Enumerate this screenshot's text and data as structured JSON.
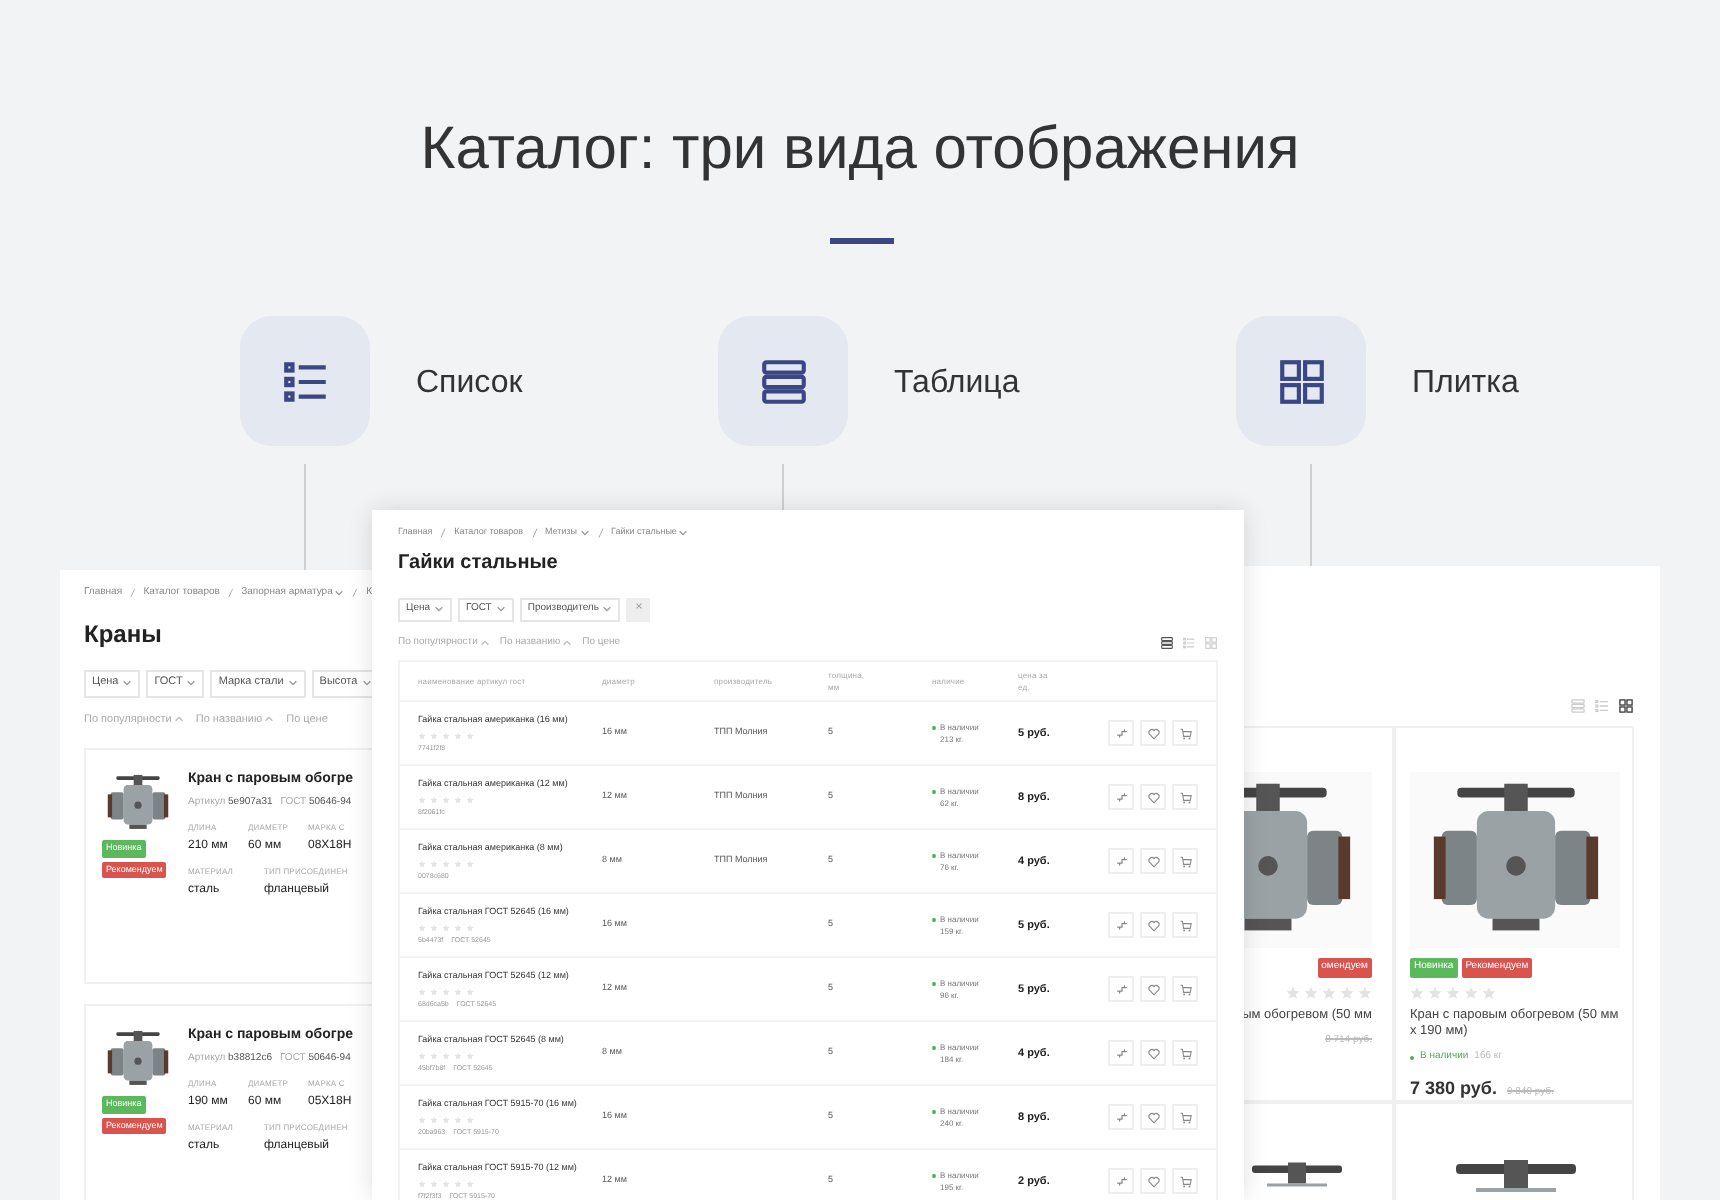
{
  "heading": {
    "title": "Каталог: три вида отображения",
    "views": [
      {
        "kind": "list",
        "label": "Список"
      },
      {
        "kind": "table",
        "label": "Таблица"
      },
      {
        "kind": "tile",
        "label": "Плитка"
      }
    ]
  },
  "list_view": {
    "breadcrumbs": [
      {
        "label": "Главная",
        "dropdown": false
      },
      {
        "label": "Каталог товаров",
        "dropdown": false
      },
      {
        "label": "Запорная арматура",
        "dropdown": true
      },
      {
        "label": "К",
        "dropdown": false
      }
    ],
    "title": "Краны",
    "filters": [
      "Цена",
      "ГОСТ",
      "Марка стали",
      "Высота"
    ],
    "sort": [
      {
        "label": "По популярности",
        "arrow": true
      },
      {
        "label": "По названию",
        "arrow": true
      },
      {
        "label": "По цене",
        "arrow": false
      }
    ],
    "products": [
      {
        "title": "Кран с паровым обогре",
        "sku_label": "Артикул",
        "sku": "5e907a31",
        "gost_label": "ГОСТ",
        "gost": "50646-94",
        "specs": [
          {
            "label": "ДЛИНА",
            "value": "210 мм"
          },
          {
            "label": "ДИАМЕТР",
            "value": "60 мм"
          },
          {
            "label": "МАРКА С",
            "value": "08Х18Н"
          }
        ],
        "specs2": [
          {
            "label": "МАТЕРИАЛ",
            "value": "сталь"
          },
          {
            "label": "ТИП ПРИСОЕДИНЕН",
            "value": "фланцевый"
          }
        ],
        "tags": [
          {
            "label": "Новинка",
            "color": "#5cb85c"
          },
          {
            "label": "Рекомендуем",
            "color": "#d9534f"
          }
        ]
      },
      {
        "title": "Кран с паровым обогре",
        "sku_label": "Артикул",
        "sku": "b38812c6",
        "gost_label": "ГОСТ",
        "gost": "50646-94",
        "specs": [
          {
            "label": "ДЛИНА",
            "value": "190 мм"
          },
          {
            "label": "ДИАМЕТР",
            "value": "60 мм"
          },
          {
            "label": "МАРКА С",
            "value": "05Х18Н"
          }
        ],
        "specs2": [
          {
            "label": "МАТЕРИАЛ",
            "value": "сталь"
          },
          {
            "label": "ТИП ПРИСОЕДИНЕН",
            "value": "фланцевый"
          }
        ],
        "tags": [
          {
            "label": "Новинка",
            "color": "#5cb85c"
          },
          {
            "label": "Рекомендуем",
            "color": "#d9534f"
          }
        ]
      }
    ]
  },
  "table_view": {
    "breadcrumbs": [
      {
        "label": "Главная",
        "dropdown": false
      },
      {
        "label": "Каталог товаров",
        "dropdown": false
      },
      {
        "label": "Метизы",
        "dropdown": true
      },
      {
        "label": "Гайки стальные",
        "dropdown": true
      }
    ],
    "title": "Гайки стальные",
    "filters": [
      "Цена",
      "ГОСТ",
      "Производитель"
    ],
    "clear_button": "×",
    "sort": [
      {
        "label": "По популярности",
        "arrow": true
      },
      {
        "label": "По названию",
        "arrow": true
      },
      {
        "label": "По цене",
        "arrow": false
      }
    ],
    "view_switch": [
      {
        "kind": "table",
        "selected": true
      },
      {
        "kind": "list",
        "selected": false
      },
      {
        "kind": "tile",
        "selected": false
      }
    ],
    "columns": [
      "наименование артикул гост",
      "диаметр",
      "производитель",
      "толщина, мм",
      "наличие",
      "цена за ед."
    ],
    "rows": [
      {
        "name": "Гайка стальная американка (16 мм)",
        "stars": 0,
        "sku": "7741f2f8",
        "diameter": "16 мм",
        "maker": "ТПП Молния",
        "thickness": "5",
        "stock_status": "В наличии",
        "stock_amount": "213 кг.",
        "price": "5 руб."
      },
      {
        "name": "Гайка стальная американка (12 мм)",
        "stars": 0,
        "sku": "8f2061fc",
        "diameter": "12 мм",
        "maker": "ТПП Молния",
        "thickness": "5",
        "stock_status": "В наличии",
        "stock_amount": "62 кг.",
        "price": "8 руб."
      },
      {
        "name": "Гайка стальная американка (8 мм)",
        "stars": 0,
        "sku": "0078c680",
        "diameter": "8 мм",
        "maker": "ТПП Молния",
        "thickness": "5",
        "stock_status": "В наличии",
        "stock_amount": "76 кг.",
        "price": "4 руб."
      },
      {
        "name": "Гайка стальная ГОСТ 52645 (16 мм)",
        "stars": 0,
        "sku": "5b4473f",
        "gost": "ГОСТ 52645",
        "diameter": "16 мм",
        "thickness": "5",
        "stock_status": "В наличии",
        "stock_amount": "159 кг.",
        "price": "5 руб."
      },
      {
        "name": "Гайка стальная ГОСТ 52645 (12 мм)",
        "stars": 0,
        "sku": "68d6ca5b",
        "gost": "ГОСТ 52645",
        "diameter": "12 мм",
        "thickness": "5",
        "stock_status": "В наличии",
        "stock_amount": "96 кг.",
        "price": "5 руб."
      },
      {
        "name": "Гайка стальная ГОСТ 52645 (8 мм)",
        "stars": 0,
        "sku": "45bf7b8f",
        "gost": "ГОСТ 52645",
        "diameter": "8 мм",
        "thickness": "5",
        "stock_status": "В наличии",
        "stock_amount": "184 кг.",
        "price": "4 руб."
      },
      {
        "name": "Гайка стальная ГОСТ 5915-70 (16 мм)",
        "stars": 0,
        "sku": "20ba963",
        "gost": "ГОСТ 5915-70",
        "diameter": "16 мм",
        "thickness": "5",
        "stock_status": "В наличии",
        "stock_amount": "240 кг.",
        "price": "8 руб."
      },
      {
        "name": "Гайка стальная ГОСТ 5915-70 (12 мм)",
        "stars": 0,
        "sku": "f7f2f3f3",
        "gost": "ГОСТ 5915-70",
        "diameter": "12 мм",
        "thickness": "5",
        "stock_status": "В наличии",
        "stock_amount": "195 кг.",
        "price": "2 руб."
      }
    ]
  },
  "tile_view": {
    "view_switch": [
      {
        "kind": "table",
        "selected": false
      },
      {
        "kind": "list",
        "selected": false
      },
      {
        "kind": "tile",
        "selected": true
      }
    ],
    "tiles": [
      {
        "tags": [
          {
            "label": "омендуем",
            "color": "#d9534f"
          }
        ],
        "stars": 0,
        "title": "ым обогревом (50 мм",
        "old_price": "8 714 руб."
      },
      {
        "tags": [
          {
            "label": "Новинка",
            "color": "#5cb85c"
          },
          {
            "label": "Рекомендуем",
            "color": "#d9534f"
          }
        ],
        "stars": 0,
        "title": "Кран с паровым обогревом (50 мм х 190 мм)",
        "stock_status": "В наличии",
        "stock_amount": "166 кг",
        "price": "7 380 руб.",
        "old_price": "9 840 руб."
      }
    ]
  }
}
